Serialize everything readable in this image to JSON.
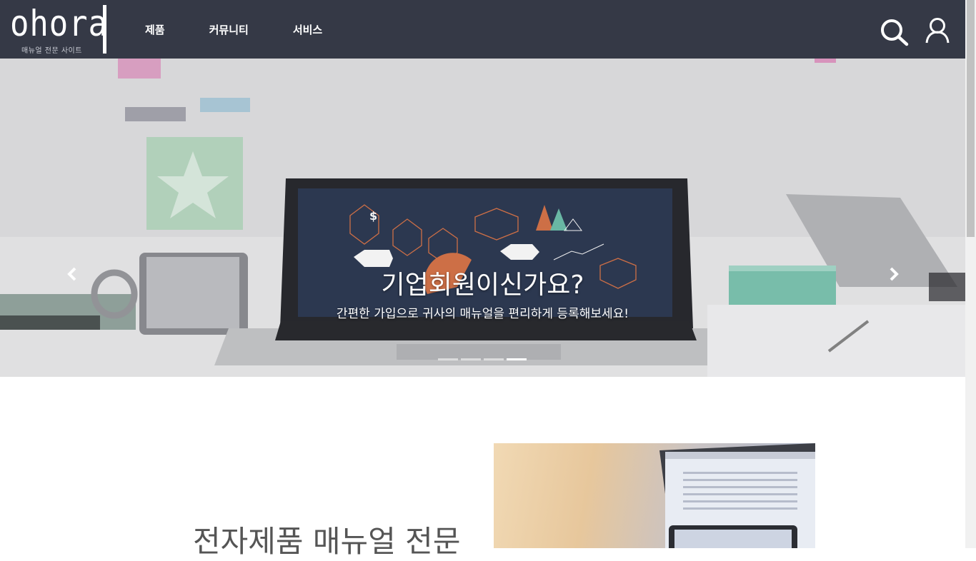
{
  "header": {
    "logo_text": "ohora",
    "logo_subtitle": "매뉴얼 전문 사이트",
    "nav": [
      {
        "label": "제품"
      },
      {
        "label": "커뮤니티"
      },
      {
        "label": "서비스"
      }
    ],
    "icons": {
      "search": "search-icon",
      "user": "user-icon"
    },
    "bg_color": "#353946"
  },
  "hero": {
    "title": "기업회원이신가요?",
    "subtitle": "간편한 가입으로 귀사의 매뉴얼을 편리하게 등록해보세요!",
    "slide_count": 4,
    "active_slide": 4,
    "screen_symbol": "$"
  },
  "content": {
    "heading": "전자제품 매뉴얼 전문"
  }
}
